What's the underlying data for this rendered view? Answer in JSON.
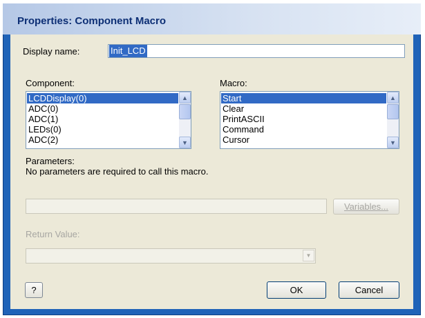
{
  "window": {
    "title": "Properties: Component Macro"
  },
  "display_name": {
    "label": "Display name:",
    "value": "Init_LCD"
  },
  "component": {
    "label": "Component:",
    "items": [
      "LCDDisplay(0)",
      "ADC(0)",
      "ADC(1)",
      "LEDs(0)",
      "ADC(2)"
    ],
    "selected_index": 0
  },
  "macro": {
    "label": "Macro:",
    "items": [
      "Start",
      "Clear",
      "PrintASCII",
      "Command",
      "Cursor"
    ],
    "selected_index": 0
  },
  "parameters": {
    "label": "Parameters:",
    "message": "No parameters are required to call this macro.",
    "input_value": "",
    "variables_button": "Variables..."
  },
  "return_value": {
    "label": "Return Value:",
    "value": ""
  },
  "buttons": {
    "help": "?",
    "ok": "OK",
    "cancel": "Cancel"
  },
  "colors": {
    "accent": "#316ac5",
    "frame": "#1f63b8",
    "dialog_bg": "#ece9d8",
    "title_text": "#0d2f75"
  }
}
